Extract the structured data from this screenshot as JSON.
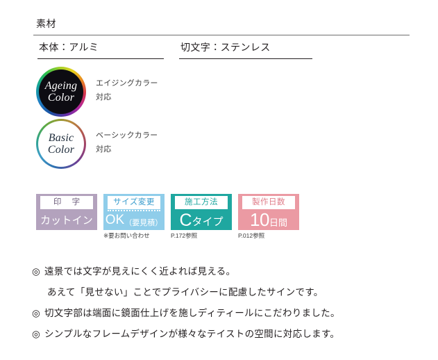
{
  "section": {
    "title": "素材"
  },
  "materials": [
    {
      "name": "material-body",
      "label": "本体：アルミ"
    },
    {
      "name": "material-letter",
      "label": "切文字：ステンレス"
    }
  ],
  "color_badges": [
    {
      "id": "ageing-color",
      "line1": "Ageing",
      "line2": "Color",
      "caption_line1": "エイジングカラー",
      "caption_line2": "対応",
      "style": "dark",
      "ring_colors": [
        "#1b4fa0",
        "#15a39a",
        "#9ed02a",
        "#e8d21f",
        "#d6354f",
        "#b3279b"
      ]
    },
    {
      "id": "basic-color",
      "line1": "Basic",
      "line2": "Color",
      "caption_line1": "ベーシックカラー",
      "caption_line2": "対応",
      "style": "light",
      "ring_colors": [
        "#2f6fb0",
        "#2fa38c",
        "#8f9f33",
        "#b35a4e",
        "#9c3f6e",
        "#6a4196"
      ]
    }
  ],
  "specs": [
    {
      "id": "printing",
      "head": "印 字",
      "value": "カットイン",
      "note": "",
      "color": "#b3a2bd"
    },
    {
      "id": "size-change",
      "head": "サイズ変更",
      "value_main": "OK",
      "value_sub": "（要見積）",
      "note": "※要お問い合わせ",
      "color": "#8fcdea"
    },
    {
      "id": "install-method",
      "head": "施工方法",
      "value_main": "C",
      "value_sub": "タイプ",
      "note": "P.172参照",
      "color": "#1fa7a0"
    },
    {
      "id": "production-days",
      "head": "製作日数",
      "value_main": "10",
      "value_sub": "日間",
      "note": "P.012参照",
      "color": "#eb9aa3"
    }
  ],
  "notes": [
    {
      "id": "note-1",
      "bullet": "◎",
      "text": "遠景では文字が見えにくく近よれば見える。",
      "indent": false
    },
    {
      "id": "note-2",
      "bullet": "",
      "text": "あえて「見せない」ことでプライバシーに配慮したサインです。",
      "indent": true
    },
    {
      "id": "note-3",
      "bullet": "◎",
      "text": "切文字部は端面に鏡面仕上げを施しディティールにこだわりました。",
      "indent": false
    },
    {
      "id": "note-4",
      "bullet": "◎",
      "text": "シンプルなフレームデザインが様々なテイストの空間に対応します。",
      "indent": false
    }
  ]
}
